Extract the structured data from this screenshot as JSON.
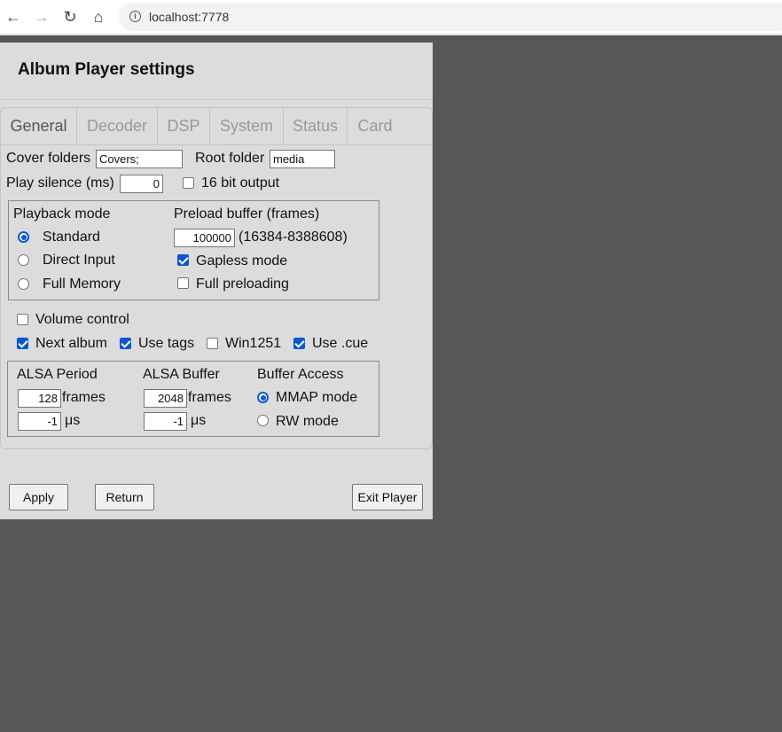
{
  "browser": {
    "url": "localhost:7778"
  },
  "page": {
    "title": "Album Player settings",
    "tabs": [
      "General",
      "Decoder",
      "DSP",
      "System",
      "Status",
      "Card"
    ],
    "general": {
      "cover_folders_label": "Cover folders",
      "cover_folders_value": "Covers;",
      "root_folder_label": "Root folder",
      "root_folder_value": "media",
      "play_silence_label": "Play silence (ms)",
      "play_silence_value": "0",
      "bit16_label": "16 bit output",
      "bit16_checked": false,
      "playback_mode_label": "Playback mode",
      "playback_modes": [
        "Standard",
        "Direct Input",
        "Full Memory"
      ],
      "playback_mode_selected": "Standard",
      "preload_label": "Preload buffer (frames)",
      "preload_value": "100000",
      "preload_range": "(16384-8388608)",
      "gapless_label": "Gapless mode",
      "gapless_checked": true,
      "full_preloading_label": "Full preloading",
      "full_preloading_checked": false,
      "volume_control_label": "Volume control",
      "volume_control_checked": false,
      "next_album_label": "Next album",
      "next_album_checked": true,
      "use_tags_label": "Use tags",
      "use_tags_checked": true,
      "win1251_label": "Win1251",
      "win1251_checked": false,
      "use_cue_label": "Use .cue",
      "use_cue_checked": true,
      "alsa_period_label": "ALSA Period",
      "alsa_period_frames": "128",
      "alsa_period_us": "-1",
      "alsa_buffer_label": "ALSA Buffer",
      "alsa_buffer_frames": "2048",
      "alsa_buffer_us": "-1",
      "frames_unit": "frames",
      "us_unit": "μs",
      "buffer_access_label": "Buffer Access",
      "mmap_label": "MMAP mode",
      "rw_label": "RW mode",
      "buffer_access_selected": "MMAP mode"
    },
    "buttons": {
      "apply": "Apply",
      "return": "Return",
      "exit": "Exit Player"
    }
  }
}
